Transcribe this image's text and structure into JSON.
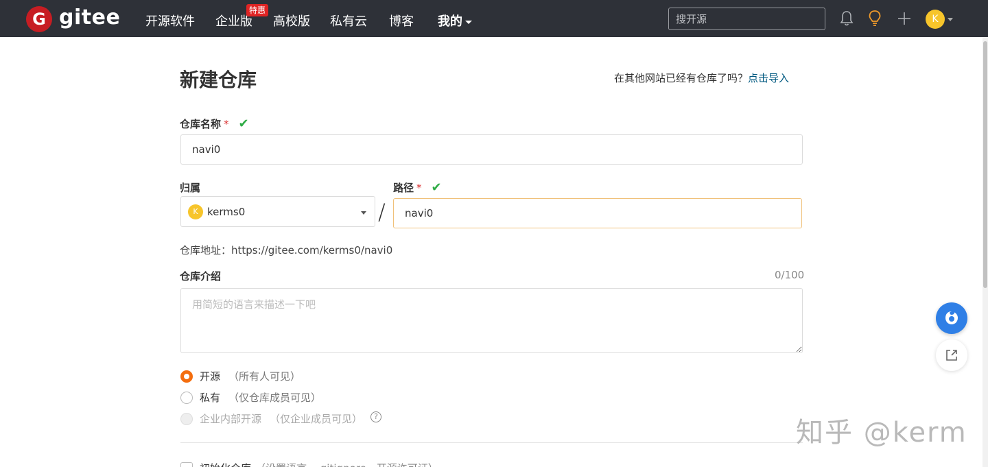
{
  "nav": {
    "logo_letter": "G",
    "logo_text": "gitee",
    "items": [
      "开源软件",
      "企业版",
      "高校版",
      "私有云",
      "博客"
    ],
    "badge": "特惠",
    "me": "我的",
    "search_placeholder": "搜开源",
    "avatar_letter": "K"
  },
  "page": {
    "title": "新建仓库",
    "import_hint": "在其他网站已经有仓库了吗？",
    "import_link": "点击导入"
  },
  "form": {
    "name_label": "仓库名称",
    "name_value": "navi0",
    "owner_label": "归属",
    "owner_avatar": "K",
    "owner_value": "kerms0",
    "slash": "/",
    "path_label": "路径",
    "path_value": "navi0",
    "required_mark": "*",
    "check_mark": "✔",
    "url_line": "仓库地址：https://gitee.com/kerms0/navi0",
    "desc_label": "仓库介绍",
    "desc_counter": "0/100",
    "desc_placeholder": "用简短的语言来描述一下吧",
    "visibility": [
      {
        "label": "开源",
        "sub": "（所有人可见）",
        "selected": true,
        "disabled": false
      },
      {
        "label": "私有",
        "sub": "（仅仓库成员可见）",
        "selected": false,
        "disabled": false
      },
      {
        "label": "企业内部开源",
        "sub": "（仅企业成员可见）",
        "selected": false,
        "disabled": true
      }
    ],
    "help_glyph": "?",
    "init_label": "初始化仓库",
    "init_sub": "（设置语言、.gitignore、开源许可证）"
  },
  "watermark": "知乎 @kerm",
  "colors": {
    "nav_bg": "#2e3138",
    "logo_red": "#c71d23",
    "link": "#005980",
    "radio_on": "#f46d0e",
    "check_green": "#2fac46",
    "float_blue": "#2f7fe6"
  }
}
